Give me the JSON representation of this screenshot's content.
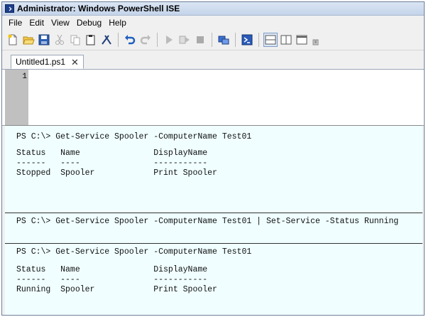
{
  "window": {
    "title": "Administrator: Windows PowerShell ISE"
  },
  "menu": {
    "items": [
      "File",
      "Edit",
      "View",
      "Debug",
      "Help"
    ]
  },
  "toolbar": {
    "icons": [
      "new-file-icon",
      "open-folder-icon",
      "save-icon",
      "cut-icon",
      "copy-icon",
      "paste-icon",
      "clear-console-icon",
      "undo-icon",
      "redo-icon",
      "run-icon",
      "run-selection-icon",
      "stop-icon",
      "remote-powershell-icon",
      "powershell-console-icon",
      "layout-top-icon",
      "layout-right-icon",
      "layout-maximize-icon",
      "show-command-icon"
    ]
  },
  "tabs": [
    {
      "label": "Untitled1.ps1",
      "close_glyph": "✕"
    }
  ],
  "editor": {
    "line_numbers": [
      "1"
    ]
  },
  "console": {
    "block1": {
      "command": "PS C:\\> Get-Service Spooler -ComputerName Test01",
      "header": "Status   Name               DisplayName",
      "dashes": "------   ----               -----------",
      "row": "Stopped  Spooler            Print Spooler"
    },
    "block2": {
      "command": "PS C:\\> Get-Service Spooler -ComputerName Test01 | Set-Service -Status Running"
    },
    "block3": {
      "command": "PS C:\\> Get-Service Spooler -ComputerName Test01",
      "header": "Status   Name               DisplayName",
      "dashes": "------   ----               -----------",
      "row": "Running  Spooler            Print Spooler"
    }
  },
  "colors": {
    "console_bg": "#f0feff",
    "gutter": "#c0c0c0",
    "titlebar": "#c4d4ea"
  }
}
